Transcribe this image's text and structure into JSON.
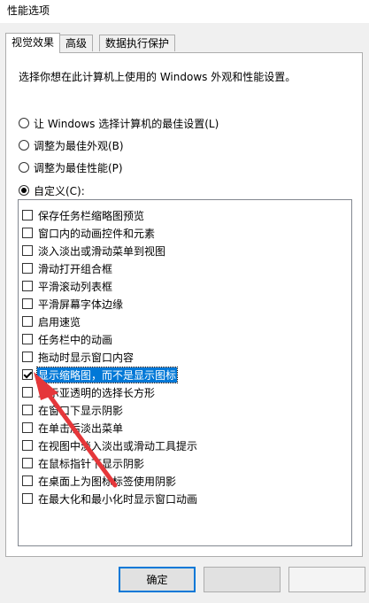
{
  "window": {
    "title": "性能选项"
  },
  "tabs": [
    {
      "label": "视觉效果"
    },
    {
      "label": "高级"
    },
    {
      "label": "数据执行保护"
    }
  ],
  "description": "选择你想在此计算机上使用的 Windows 外观和性能设置。",
  "radios": [
    {
      "label": "让 Windows 选择计算机的最佳设置(L)",
      "selected": false
    },
    {
      "label": "调整为最佳外观(B)",
      "selected": false
    },
    {
      "label": "调整为最佳性能(P)",
      "selected": false
    },
    {
      "label": "自定义(C):",
      "selected": true
    }
  ],
  "options": [
    {
      "label": "保存任务栏缩略图预览",
      "checked": false
    },
    {
      "label": "窗口内的动画控件和元素",
      "checked": false
    },
    {
      "label": "淡入淡出或滑动菜单到视图",
      "checked": false
    },
    {
      "label": "滑动打开组合框",
      "checked": false
    },
    {
      "label": "平滑滚动列表框",
      "checked": false
    },
    {
      "label": "平滑屏幕字体边缘",
      "checked": false
    },
    {
      "label": "启用速览",
      "checked": false
    },
    {
      "label": "任务栏中的动画",
      "checked": false
    },
    {
      "label": "拖动时显示窗口内容",
      "checked": false
    },
    {
      "label": "显示缩略图，而不是显示图标",
      "checked": true,
      "highlighted": true
    },
    {
      "label": "显示亚透明的选择长方形",
      "checked": false
    },
    {
      "label": "在窗口下显示阴影",
      "checked": false
    },
    {
      "label": "在单击后淡出菜单",
      "checked": false
    },
    {
      "label": "在视图中淡入淡出或滑动工具提示",
      "checked": false
    },
    {
      "label": "在鼠标指针下显示阴影",
      "checked": false
    },
    {
      "label": "在桌面上为图标标签使用阴影",
      "checked": false
    },
    {
      "label": "在最大化和最小化时显示窗口动画",
      "checked": false
    }
  ],
  "buttons": {
    "ok": "确定"
  },
  "colors": {
    "highlight": "#0078d7",
    "arrow": "#e5373a"
  }
}
